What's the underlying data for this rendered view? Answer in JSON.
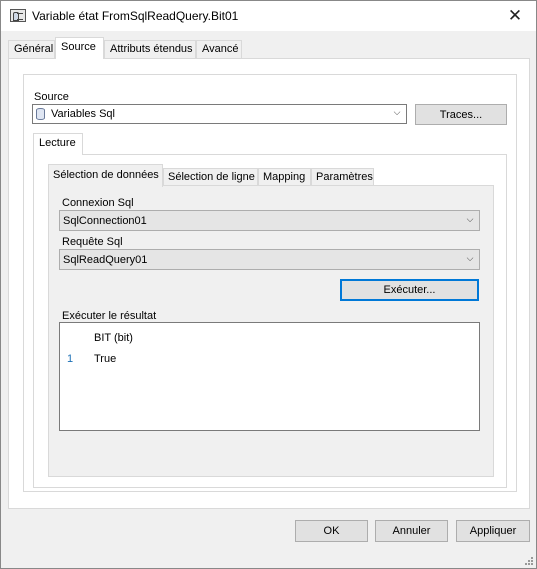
{
  "window": {
    "title": "Variable état FromSqlReadQuery.Bit01",
    "close_symbol": "✕"
  },
  "tabs": [
    {
      "label": "Général"
    },
    {
      "label": "Source",
      "active": true
    },
    {
      "label": "Attributs étendus"
    },
    {
      "label": "Avancé"
    }
  ],
  "source": {
    "group_label": "Source",
    "selected": "Variables Sql",
    "icon": "database-icon",
    "traces_button": "Traces..."
  },
  "lecture": {
    "tab_label": "Lecture",
    "inner_tabs": [
      {
        "label": "Sélection de données",
        "active": true
      },
      {
        "label": "Sélection de ligne"
      },
      {
        "label": "Mapping"
      },
      {
        "label": "Paramètres"
      }
    ],
    "connexion_label": "Connexion Sql",
    "connexion_value": "SqlConnection01",
    "requete_label": "Requête Sql",
    "requete_value": "SqlReadQuery01",
    "execute_button": "Exécuter...",
    "result_label": "Exécuter le résultat",
    "result_column": "BIT (bit)",
    "result_rows": [
      {
        "index": "1",
        "value": "True"
      }
    ]
  },
  "footer": {
    "ok": "OK",
    "cancel": "Annuler",
    "apply": "Appliquer"
  },
  "colors": {
    "accent": "#0078d7",
    "row_number": "#1a6fb5"
  }
}
